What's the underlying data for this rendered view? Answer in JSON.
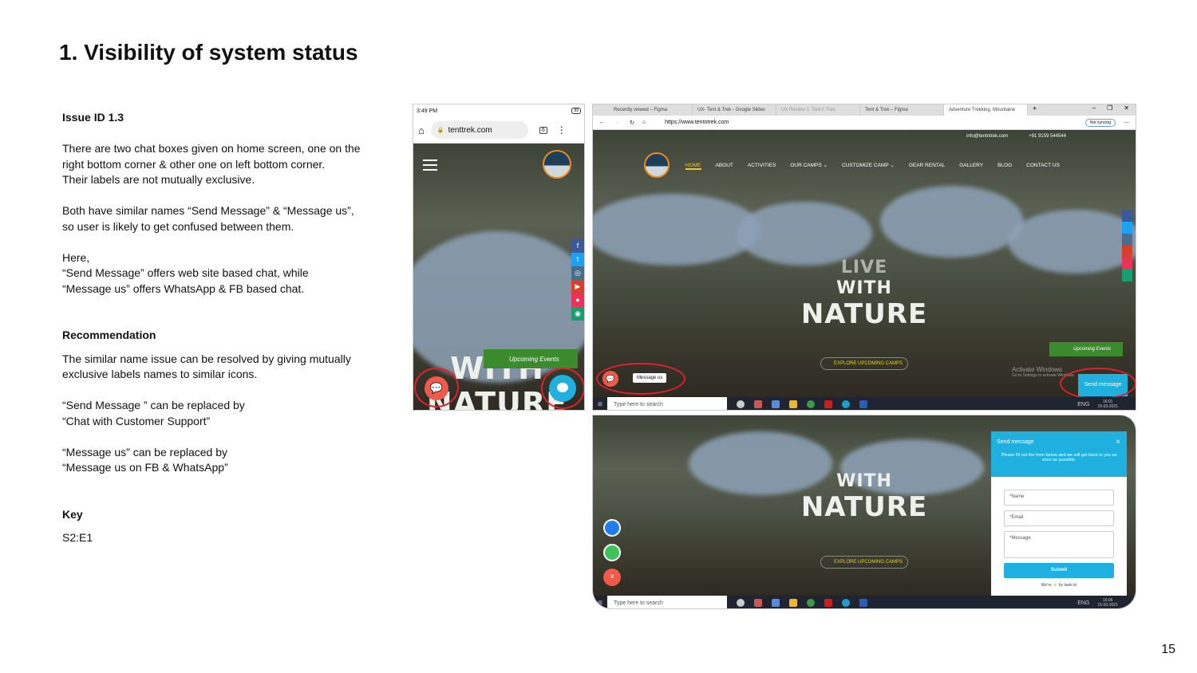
{
  "slide": {
    "title": "1. Visibility of system status",
    "page_number": "15"
  },
  "issue": {
    "id": "Issue ID 1.3",
    "paragraphs": [
      "There are two chat boxes given on home screen, one on the right bottom corner & other one on left bottom corner.",
      "Their labels are not mutually exclusive.",
      "Both have similar names “Send Message” & “Message us”, so user is likely to get confused between them.",
      "Here,",
      "“Send Message” offers web site based chat, while",
      "“Message us” offers WhatsApp & FB based chat."
    ]
  },
  "recommendation": {
    "heading": "Recommendation",
    "paragraphs": [
      "The similar name  issue can be resolved by giving mutually exclusive labels names to similar icons.",
      "“Send Message ” can be replaced by",
      "“Chat with Customer Support”",
      "“Message us” can be replaced by",
      "“Message us on FB & WhatsApp”"
    ]
  },
  "key": {
    "heading": "Key",
    "value": "S2:E1"
  },
  "mobile": {
    "time": "3:49 PM",
    "battery": "89",
    "url": "tenttrek.com",
    "tabs_count": "6",
    "hero_text": "WITH NATURE",
    "upcoming_events": "Upcoming Events",
    "left_chat_icon": "chat-bubbles-icon",
    "right_chat_icon": "chat-bubble-icon",
    "left_chat_color": "#f05a4a",
    "right_chat_color": "#1fb0e0"
  },
  "desktop": {
    "tabs": [
      "Recently viewed – Figma",
      "UX- Tent & Trek - Google Slides",
      "UX Review 1: Tent n Trek",
      "Tent & Trek – Figma",
      "Adventure Trekking, Mountaine"
    ],
    "url": "https://www.tentntrek.com",
    "sync": "Not syncing",
    "email": "info@tentntrek.com",
    "phone": "+91 9159 544544",
    "nav": [
      "HOME",
      "ABOUT",
      "ACTIVITIES",
      "OUR CAMPS ⌄",
      "CUSTOMIZE CAMP ⌄",
      "GEAR RENTAL",
      "GALLERY",
      "BLOG",
      "CONTACT US"
    ],
    "hero_line1": "LIVE",
    "hero_line2": "WITH",
    "hero_line3": "NATURE",
    "explore": "EXPLORE UPCOMING CAMPS",
    "upcoming_events": "Upcoming Events",
    "message_us": "Message us",
    "send_message": "Send message",
    "activate": "Activate Windows",
    "activate_sub": "Go to Settings to activate Windows.",
    "taskbar_search": "Type here to search",
    "lang": "ENG",
    "time1": "16:01",
    "time2": "16:06",
    "date": "15-03-2021",
    "accent": "#1fb0e0",
    "nav_active": "#f3c316"
  },
  "chat_form": {
    "title": "Send message",
    "close": "×",
    "subtitle": "Please fill out the form below and we will get back to you as soon as possible.",
    "name": "*Name",
    "email": "*Email",
    "message": "*Message",
    "submit": "Submit",
    "powered": "We’re ⚡ by tawk.to"
  }
}
